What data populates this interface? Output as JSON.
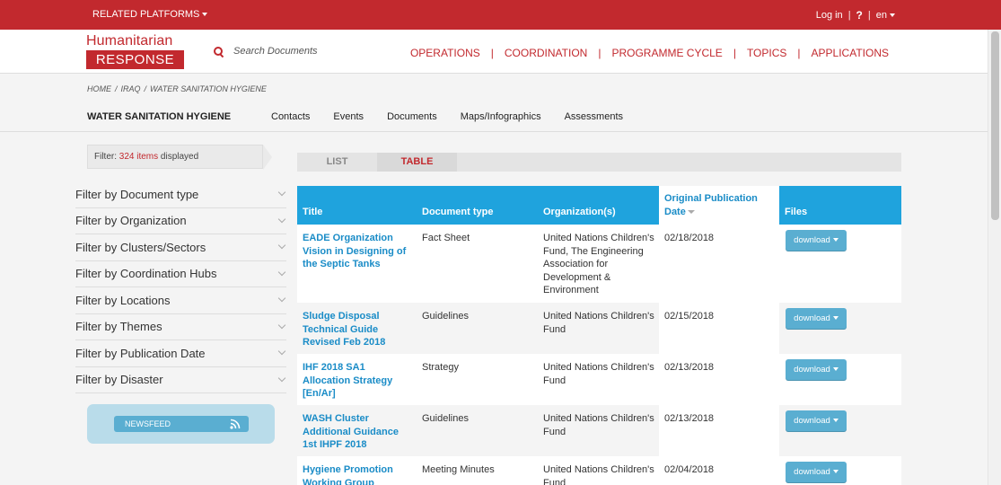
{
  "topbar": {
    "related_label": "RELATED PLATFORMS",
    "login_label": "Log in",
    "help_label": "?",
    "language": "en"
  },
  "header": {
    "logo_line1": "Humanitarian",
    "logo_line2": "RESPONSE",
    "search_placeholder": "Search Documents",
    "nav": [
      "OPERATIONS",
      "COORDINATION",
      "PROGRAMME CYCLE",
      "TOPICS",
      "APPLICATIONS"
    ]
  },
  "subbar": {
    "breadcrumb": [
      "HOME",
      "IRAQ",
      "WATER SANITATION HYGIENE"
    ],
    "section_title": "WATER SANITATION HYGIENE",
    "subnav": [
      "Contacts",
      "Events",
      "Documents",
      "Maps/Infographics",
      "Assessments"
    ]
  },
  "filter_summary": {
    "prefix": "Filter:",
    "count": "324 items",
    "suffix": "displayed"
  },
  "filters": [
    "Filter by Document type",
    "Filter by Organization",
    "Filter by Clusters/Sectors",
    "Filter by Coordination Hubs",
    "Filter by Locations",
    "Filter by Themes",
    "Filter by Publication Date",
    "Filter by Disaster"
  ],
  "newsfeed_label": "NEWSFEED",
  "view_tabs": {
    "list": "LIST",
    "table": "TABLE",
    "active": "table"
  },
  "table": {
    "headers": {
      "title": "Title",
      "type": "Document type",
      "org": "Organization(s)",
      "date": "Original Publication Date",
      "files": "Files"
    },
    "download_label": "download",
    "rows": [
      {
        "title": "EADE Organization Vision in Designing of the Septic Tanks",
        "type": "Fact Sheet",
        "org": "United Nations Children's Fund, The Engineering Association for Development & Environment",
        "date": "02/18/2018"
      },
      {
        "title": "Sludge Disposal Technical Guide Revised Feb 2018",
        "type": "Guidelines",
        "org": "United Nations Children's Fund",
        "date": "02/15/2018"
      },
      {
        "title": "IHF 2018 SA1 Allocation Strategy [En/Ar]",
        "type": "Strategy",
        "org": "United Nations Children's Fund",
        "date": "02/13/2018"
      },
      {
        "title": "WASH Cluster Additional Guidance 1st IHPF 2018",
        "type": "Guidelines",
        "org": "United Nations Children's Fund",
        "date": "02/13/2018"
      },
      {
        "title": "Hygiene Promotion Working Group",
        "type": "Meeting Minutes",
        "org": "United Nations Children's Fund",
        "date": "02/04/2018"
      }
    ]
  },
  "colors": {
    "brand_red": "#c2292e",
    "table_header_blue": "#1fa3dd",
    "link_blue": "#1a8cc7",
    "button_blue": "#5aaed1"
  }
}
